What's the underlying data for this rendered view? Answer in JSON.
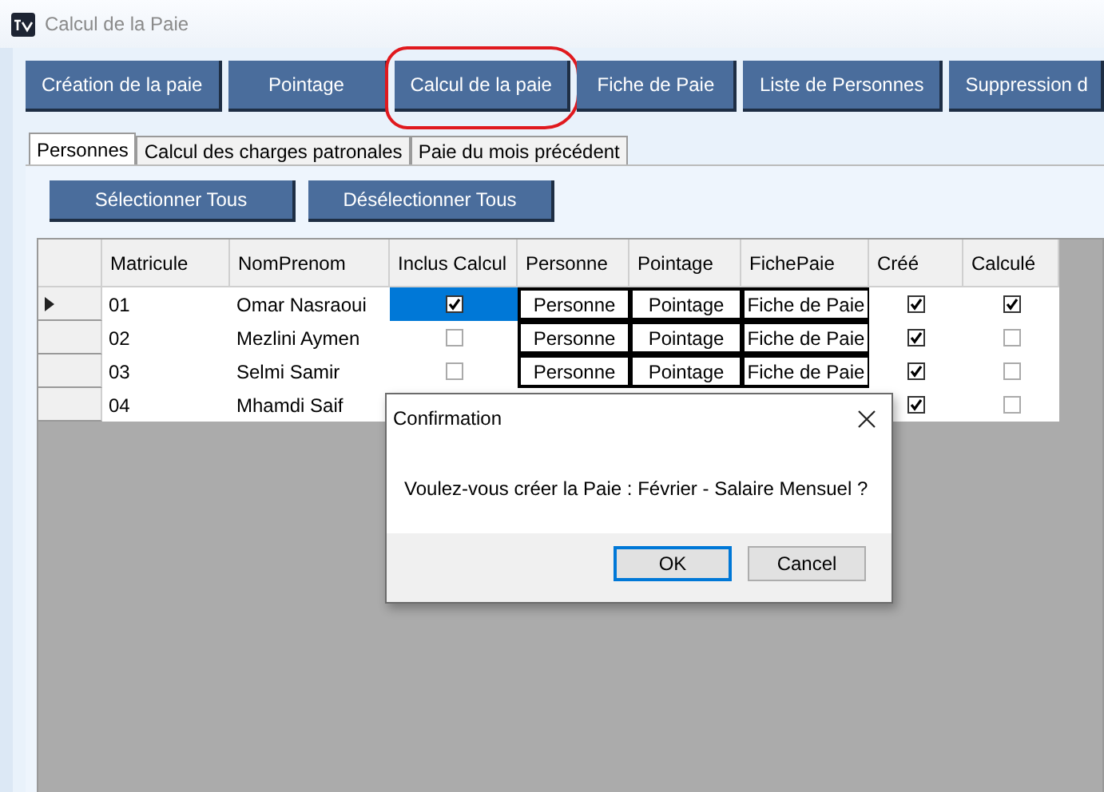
{
  "window": {
    "title": "Calcul de la Paie"
  },
  "toolbar": [
    {
      "label": "Création de la paie",
      "annotated": false
    },
    {
      "label": "Pointage",
      "annotated": false
    },
    {
      "label": "Calcul de la paie",
      "annotated": true
    },
    {
      "label": "Fiche de Paie",
      "annotated": false
    },
    {
      "label": "Liste de Personnes",
      "annotated": false
    },
    {
      "label": "Suppression d",
      "annotated": false
    }
  ],
  "tabs": [
    {
      "label": "Personnes",
      "selected": true
    },
    {
      "label": "Calcul des charges patronales",
      "selected": false
    },
    {
      "label": "Paie du mois précédent",
      "selected": false
    }
  ],
  "actions": [
    "Sélectionner Tous",
    "Désélectionner Tous"
  ],
  "table": {
    "columns": [
      "Matricule",
      "NomPrenom",
      "Inclus Calcul",
      "Personne",
      "Pointage",
      "FichePaie",
      "Créé",
      "Calculé"
    ],
    "rows": [
      {
        "selected": true,
        "matricule": "01",
        "nom": "Omar  Nasraoui",
        "inclus": true,
        "personne": "Personne",
        "pointage": "Pointage",
        "fiche": "Fiche de Paie",
        "cree": true,
        "calcule": true
      },
      {
        "selected": false,
        "matricule": "02",
        "nom": "Mezlini  Aymen",
        "inclus": false,
        "personne": "Personne",
        "pointage": "Pointage",
        "fiche": "Fiche de Paie",
        "cree": true,
        "calcule": false
      },
      {
        "selected": false,
        "matricule": "03",
        "nom": "Selmi  Samir",
        "inclus": false,
        "personne": "Personne",
        "pointage": "Pointage",
        "fiche": "Fiche de Paie",
        "cree": true,
        "calcule": false
      },
      {
        "selected": false,
        "matricule": "04",
        "nom": "Mhamdi  Saif",
        "cree": true,
        "calcule": false
      }
    ]
  },
  "dialog": {
    "title": "Confirmation",
    "message": "Voulez-vous créer la Paie : Février - Salaire Mensuel ?",
    "buttons": [
      "OK",
      "Cancel"
    ]
  }
}
